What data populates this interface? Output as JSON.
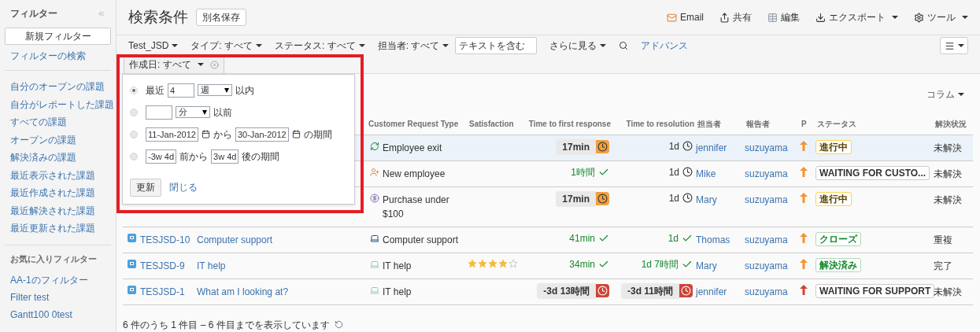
{
  "sidebar": {
    "title": "フィルター",
    "new_filter_button": "新規フィルター",
    "search_link": "フィルターの検索",
    "system_filters": [
      "自分のオープンの課題",
      "自分がレポートした課題",
      "すべての課題",
      "オープンの課題",
      "解決済みの課題",
      "最近表示された課題",
      "最近作成された課題",
      "最近解決された課題",
      "最近更新された課題"
    ],
    "favorites_title": "お気に入りフィルター",
    "favorites": [
      "AA-1のフィルター",
      "Filter test",
      "Gantt100 0test"
    ]
  },
  "header": {
    "title": "検索条件",
    "save_as_button": "別名保存",
    "actions": [
      {
        "kind": "email",
        "label": "Email",
        "dropdown": false
      },
      {
        "kind": "share",
        "label": "共有",
        "dropdown": false
      },
      {
        "kind": "edit",
        "label": "編集",
        "dropdown": false
      },
      {
        "kind": "export",
        "label": "エクスポート",
        "dropdown": true
      },
      {
        "kind": "tools",
        "label": "ツール",
        "dropdown": true
      }
    ]
  },
  "filters": {
    "criteria": [
      "Test_JSD",
      "タイプ: すべて",
      "ステータス: すべて",
      "担当者: すべて"
    ],
    "text_search": {
      "placeholder": "テキストを含む"
    },
    "more": "さらに見る",
    "advanced": "アドバンス",
    "extra_criterion": {
      "label": "作成日: すべて",
      "expanded": true
    }
  },
  "date_popup": {
    "options": [
      {
        "kind": "within",
        "selected": true,
        "prefix": "最近",
        "value": "4",
        "unit": "週",
        "suffix": "以内"
      },
      {
        "kind": "before",
        "selected": false,
        "unit": "分",
        "suffix": "以前"
      },
      {
        "kind": "range",
        "selected": false,
        "from": "11-Jan-2012",
        "middle": "から",
        "to": "30-Jan-2012",
        "suffix": "の期間"
      },
      {
        "kind": "relative",
        "selected": false,
        "from": "-3w 4d",
        "middle": "前から",
        "to": "3w 4d",
        "suffix": "後の期間"
      }
    ],
    "update_button": "更新",
    "close_link": "閉じる"
  },
  "columns_button": "コラム",
  "table": {
    "columns": [
      "Customer Request Type",
      "Satisfaction",
      "Time to first response",
      "Time to resolution",
      "担当者",
      "報告者",
      "P",
      "ステータス",
      "解決状況"
    ],
    "rows": [
      {
        "selected": true,
        "request_type": {
          "kind": "exit",
          "label": "Employee exit"
        },
        "first_response": {
          "kind": "running",
          "text": "17min"
        },
        "resolution_time": {
          "kind": "clock",
          "text": "1d"
        },
        "assignee": "jennifer",
        "reporter": "suzuyama",
        "priority": {
          "color": "#f79232"
        },
        "status": {
          "kind": "progress",
          "label": "進行中"
        },
        "resolution": "未解決"
      },
      {
        "selected": false,
        "request_type": {
          "kind": "new",
          "label": "New employee"
        },
        "first_response": {
          "kind": "met",
          "text": "1時間"
        },
        "resolution_time": {
          "kind": "clock",
          "text": "1d"
        },
        "assignee": "Mike",
        "reporter": "suzuyama",
        "priority": {
          "color": "#f79232"
        },
        "status": {
          "kind": "default",
          "label": "WAITING FOR CUSTO..."
        },
        "resolution": "未解決"
      },
      {
        "selected": false,
        "request_type": {
          "kind": "purchase",
          "label": "Purchase under $100"
        },
        "first_response": {
          "kind": "running",
          "text": "17min"
        },
        "resolution_time": {
          "kind": "clock",
          "text": "1d"
        },
        "assignee": "Mary",
        "reporter": "suzuyama",
        "priority": {
          "color": "#f79232"
        },
        "status": {
          "kind": "progress",
          "label": "進行中"
        },
        "resolution": "未解決"
      },
      {
        "selected": false,
        "key": "TESJSD-10",
        "summary": "Computer support",
        "request_type": {
          "kind": "computer",
          "label": "Computer support"
        },
        "first_response": {
          "kind": "met",
          "text": "41min"
        },
        "resolution_time": {
          "kind": "met",
          "text": "1d"
        },
        "assignee": "Thomas",
        "reporter": "suzuyama",
        "priority": {
          "color": "#f79232"
        },
        "status": {
          "kind": "done",
          "label": "クローズ"
        },
        "resolution": "重複"
      },
      {
        "selected": false,
        "key": "TESJSD-9",
        "summary": "IT help",
        "request_type": {
          "kind": "it",
          "label": "IT help"
        },
        "stars": 4,
        "first_response": {
          "kind": "met",
          "text": "34min"
        },
        "resolution_time": {
          "kind": "met",
          "text": "1d 7時間"
        },
        "assignee": "Mary",
        "reporter": "suzuyama",
        "priority": {
          "color": "#f79232"
        },
        "status": {
          "kind": "done",
          "label": "解決済み"
        },
        "resolution": "完了"
      },
      {
        "selected": false,
        "key": "TESJSD-1",
        "summary": "What am I looking at?",
        "request_type": {
          "kind": "it",
          "label": "IT help"
        },
        "first_response": {
          "kind": "breached",
          "text": "-3d 13時間"
        },
        "resolution_time": {
          "kind": "breached",
          "text": "-3d 11時間"
        },
        "assignee": "jennifer",
        "reporter": "suzuyama",
        "priority": {
          "color": "#d04437"
        },
        "status": {
          "kind": "default",
          "label": "WAITING FOR SUPPORT"
        },
        "resolution": "未解決"
      }
    ]
  },
  "footer": "6 件のうち 1 件目 – 6 件目までを表示しています"
}
